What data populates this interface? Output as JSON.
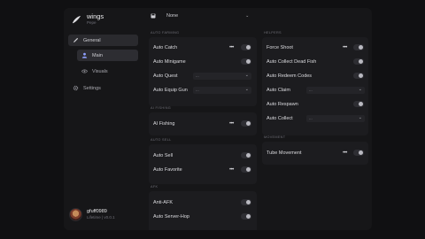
{
  "brand": {
    "title": "wings",
    "subtitle": "Pepe"
  },
  "nav": {
    "general": "General",
    "main": "Main",
    "visuals": "Visuals",
    "settings": "Settings"
  },
  "profile": {
    "name": "gfuff0989",
    "sub": "Lifetime | v0.0.1"
  },
  "topbar": {
    "label": "None"
  },
  "sections": {
    "auto_farming": "AUTO FARMING",
    "ai_fishing": "AI FISHING",
    "auto_sell": "AUTO SELL",
    "afk": "AFK",
    "helpers": "HELPERS",
    "movement": "MOVEMENT"
  },
  "left": {
    "auto_catch": "Auto Catch",
    "auto_minigame": "Auto Minigame",
    "auto_quest": "Auto Quest",
    "auto_quest_value": "...",
    "auto_equip_gun": "Auto Equip Gun",
    "auto_equip_gun_value": "...",
    "ai_fishing": "AI Fishing",
    "auto_sell": "Auto Sell",
    "auto_favorite": "Auto Favorite",
    "anti_afk": "Anti-AFK",
    "auto_server_hop": "Auto Server-Hop"
  },
  "right": {
    "force_shoot": "Force Shoot",
    "auto_collect_dead_fish": "Auto Collect Dead Fish",
    "auto_redeem_codes": "Auto Redeem Codes",
    "auto_claim": "Auto Claim",
    "auto_claim_value": "...",
    "auto_respawn": "Auto Respawn",
    "auto_collect": "Auto Collect",
    "auto_collect_value": "...",
    "tube_movement": "Tube Movement"
  },
  "colors": {
    "background": "#101012",
    "panel": "#161618",
    "card": "#1c1c1f",
    "nav_active": "#2a2a2e"
  },
  "icons": [
    "wing-logo-icon",
    "pen-icon",
    "user-icon",
    "eye-icon",
    "gear-icon",
    "save-icon",
    "chevron-down-icon",
    "more-icon"
  ]
}
